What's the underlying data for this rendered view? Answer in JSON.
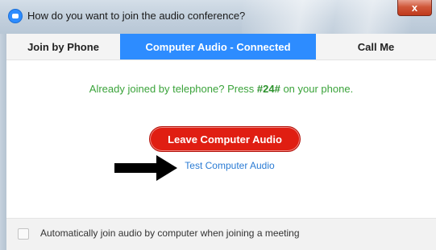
{
  "window": {
    "title": "How do you want to join the audio conference?",
    "close_label": "x"
  },
  "tabs": [
    {
      "label": "Join by Phone",
      "active": false
    },
    {
      "label": "Computer Audio - Connected",
      "active": true
    },
    {
      "label": "Call Me",
      "active": false
    }
  ],
  "main": {
    "notice_prefix": "Already joined by telephone? Press ",
    "notice_code": "#24#",
    "notice_suffix": " on your phone.",
    "leave_button": "Leave Computer Audio",
    "test_link": "Test Computer Audio"
  },
  "footer": {
    "auto_join_label": "Automatically join audio by computer when joining a meeting",
    "auto_join_checked": false
  },
  "colors": {
    "accent_blue": "#2d8cff",
    "leave_red": "#e01e12",
    "notice_green": "#3aa33a",
    "link_blue": "#2a7bd4"
  },
  "icons": [
    "zoom-app-icon",
    "close-icon",
    "arrow-annotation-icon",
    "checkbox-icon"
  ]
}
